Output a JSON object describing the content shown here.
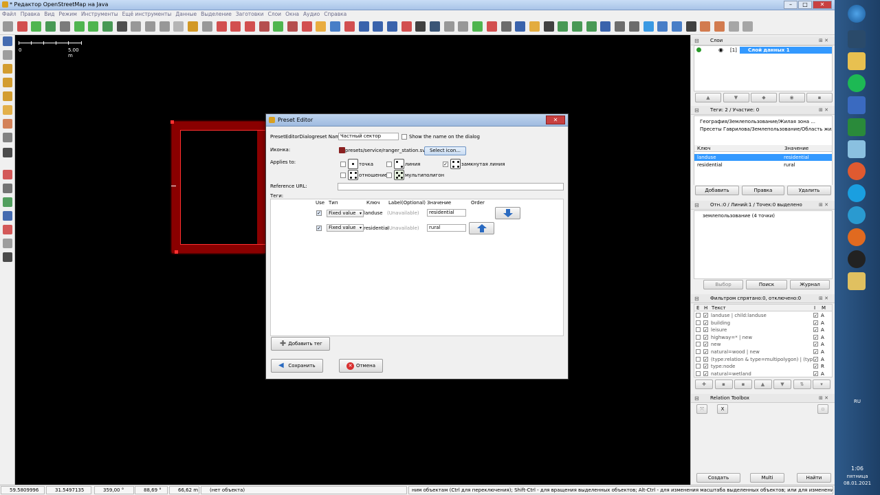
{
  "window": {
    "title": "* Редактор OpenStreetMap на Java",
    "min": "–",
    "max": "□",
    "close": "✕"
  },
  "menu": [
    "Файл",
    "Правка",
    "Вид",
    "Режим",
    "Инструменты",
    "Ещё инструменты",
    "Данные",
    "Выделение",
    "Заготовки",
    "Слои",
    "Окна",
    "Аудио",
    "Справка"
  ],
  "scale": {
    "start": "0",
    "end": "5.00 m"
  },
  "dialog": {
    "title": "Preset Editor",
    "close": "✕",
    "name_label": "PresetEditorDialogreset Name:",
    "name_value": "Частный сектор",
    "show_name_label": "Show the name on the dialog",
    "icon_label": "Иконка:",
    "icon_path": "presets/service/ranger_station.svg",
    "select_icon": "Select icon...",
    "applies_label": "Applies to:",
    "applies": {
      "node": "точка",
      "way": "линия",
      "closedway": "замкнутая линия",
      "relation": "отношение",
      "multipolygon": "мультиполигон"
    },
    "ref_url_label": "Reference URL:",
    "tags_label": "Теги:",
    "cols": {
      "use": "Use",
      "type": "Тип",
      "key": "Ключ",
      "label": "Label(Optional)",
      "value": "Значение",
      "order": "Order"
    },
    "rows": [
      {
        "type": "Fixed value",
        "key": "landuse",
        "label": "(Unavailable)",
        "value": "residential"
      },
      {
        "type": "Fixed value",
        "key": "residential",
        "label": "(Unavailable)",
        "value": "rural"
      }
    ],
    "add_tag": "Добавить тег",
    "save": "Сохранить",
    "cancel": "Отмена"
  },
  "panels": {
    "layers": {
      "title": "Слои",
      "layer_index": "[1]",
      "layer_name": "Слой данных 1"
    },
    "tags": {
      "title": "Теги: 2 / Участие: 0",
      "preset1": "География/Землепользование/Жилая зона ...",
      "preset2": "Пресеты Гаврилова/Землепользование/Область жилой ...",
      "col_key": "Ключ",
      "col_value": "Значение",
      "rows": [
        {
          "k": "landuse",
          "v": "residential"
        },
        {
          "k": "residential",
          "v": "rural"
        }
      ],
      "add": "Добавить",
      "edit": "Правка",
      "delete": "Удалить"
    },
    "selection": {
      "title": "Отн.:0 / Линий:1 / Точек:0 выделено",
      "item": "землепользование (4 точки)",
      "select": "Выбор",
      "search": "Поиск",
      "history": "Журнал"
    },
    "filter": {
      "title": "Фильтром спрятано:0, отключено:0",
      "col_e": "Е",
      "col_h": "Н",
      "col_text": "Текст",
      "col_i": "I",
      "col_m": "M",
      "rows": [
        {
          "t": "landuse | child:landuse",
          "m": "A"
        },
        {
          "t": "building",
          "m": "A"
        },
        {
          "t": "leisure",
          "m": "A"
        },
        {
          "t": "highway=* | new",
          "m": "A"
        },
        {
          "t": "new",
          "m": "A"
        },
        {
          "t": "natural=wood | new",
          "m": "A"
        },
        {
          "t": "(type:relation & type=multipolygon) | (typ...",
          "m": "A"
        },
        {
          "t": "type:node",
          "m": "R"
        },
        {
          "t": "natural=wetland",
          "m": "A"
        }
      ]
    },
    "relation": {
      "title": "Relation Toolbox",
      "create": "Создать",
      "multi": "Multi",
      "find": "Найти"
    }
  },
  "status": {
    "lat": "59.5809996",
    "lon": "31.5497135",
    "heading": "359,00 °",
    "angle": "88,69 °",
    "length": "66,62 m",
    "name": "(нет объекта)",
    "help": "ним объектам (Ctrl для переключения); Shift-Ctrl - для вращения выделенных объектов; Alt-Ctrl - для изменения масштаба выделенных объектов; или для изменения выделения"
  },
  "tray": {
    "lang": "RU",
    "time": "1:06",
    "day": "пятница",
    "date": "08.01.2021"
  }
}
